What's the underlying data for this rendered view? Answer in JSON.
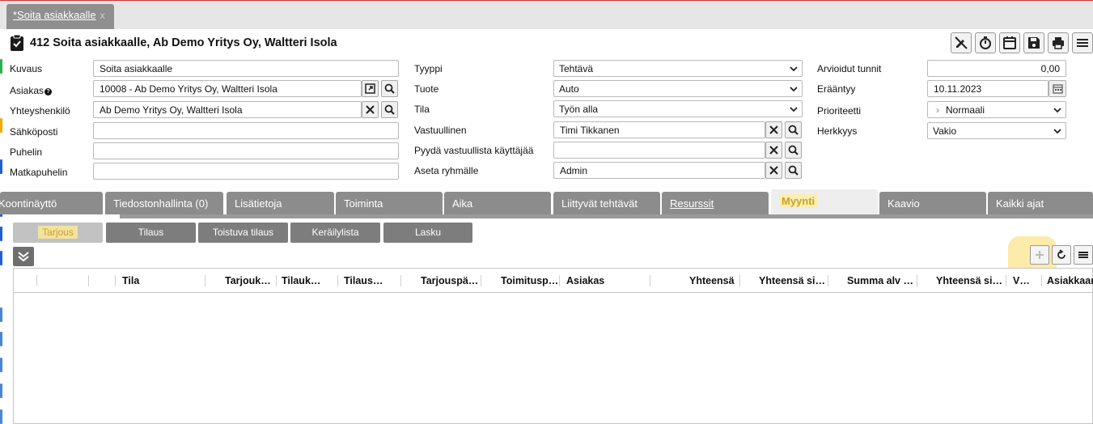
{
  "document_tab": {
    "title": "*Soita asiakkaalle",
    "close": "x"
  },
  "page_title": "412 Soita asiakkaalle, Ab Demo Yritys Oy, Waltteri Isola",
  "toolbar": {
    "icons": [
      "edit-off-icon",
      "timer-icon",
      "calendar-add-icon",
      "save-icon",
      "print-icon",
      "menu-icon"
    ]
  },
  "form": {
    "col1": {
      "kuvaus": {
        "label": "Kuvaus",
        "value": "Soita asiakkaalle"
      },
      "asiakas": {
        "label": "Asiakas",
        "value": "10008 - Ab Demo Yritys Oy, Waltteri Isola",
        "info": "?"
      },
      "yhteyshenkilo": {
        "label": "Yhteyshenkilö",
        "value": "Ab Demo Yritys Oy, Waltteri Isola"
      },
      "sahkoposti": {
        "label": "Sähköposti",
        "value": ""
      },
      "puhelin": {
        "label": "Puhelin",
        "value": ""
      },
      "matkapuhelin": {
        "label": "Matkapuhelin",
        "value": ""
      }
    },
    "col2": {
      "tyyppi": {
        "label": "Tyyppi",
        "value": "Tehtävä"
      },
      "tuote": {
        "label": "Tuote",
        "value": "Auto"
      },
      "tila": {
        "label": "Tila",
        "value": "Työn alla"
      },
      "vastuullinen": {
        "label": "Vastuullinen",
        "value": "Timi Tikkanen"
      },
      "pyyda": {
        "label": "Pyydä vastuullista käyttäjää",
        "value": ""
      },
      "ryhma": {
        "label": "Aseta ryhmälle",
        "value": "Admin"
      }
    },
    "col3": {
      "arvioidut": {
        "label": "Arvioidut tunnit",
        "value": "0,00"
      },
      "eraantyy": {
        "label": "Erääntyy",
        "value": "10.11.2023"
      },
      "prioriteetti": {
        "label": "Prioriteetti",
        "value": "Normaali",
        "marker": "›"
      },
      "herkkyys": {
        "label": "Herkkyys",
        "value": "Vakio"
      }
    }
  },
  "tabs": [
    {
      "label": "Koontinäyttö"
    },
    {
      "label": "Tiedostonhallinta (0)"
    },
    {
      "label": "Lisätietoja"
    },
    {
      "label": "Toiminta"
    },
    {
      "label": "Aika"
    },
    {
      "label": "Liittyvät tehtävät"
    },
    {
      "label": "Resurssit"
    },
    {
      "label": "Myynti",
      "active": true
    },
    {
      "label": "Kaavio"
    },
    {
      "label": "Kaikki ajat"
    }
  ],
  "subtabs": [
    {
      "label": "Tarjous",
      "active": true
    },
    {
      "label": "Tilaus"
    },
    {
      "label": "Toistuva tilaus"
    },
    {
      "label": "Keräilylista"
    },
    {
      "label": "Lasku"
    }
  ],
  "grid": {
    "columns": [
      "Tila",
      "Tarjouk…",
      "Tilauk…",
      "Tilaus…",
      "Tarjouspä…",
      "Toimitusp…",
      "Asiakas",
      "Yhteensä",
      "Yhteensä si…",
      "Summa alv …",
      "Yhteensä si…",
      "V…",
      "Asiakkaan"
    ],
    "rows": []
  },
  "colors": {
    "tab_bg": "#8c8c8c",
    "highlight": "#fbe89a",
    "highlight_text": "#c9a227",
    "marker_green": "#2bb24c",
    "marker_orange": "#f2a900",
    "marker_blue": "#1f5fd6",
    "marker_lightblue": "#4a86d6"
  }
}
